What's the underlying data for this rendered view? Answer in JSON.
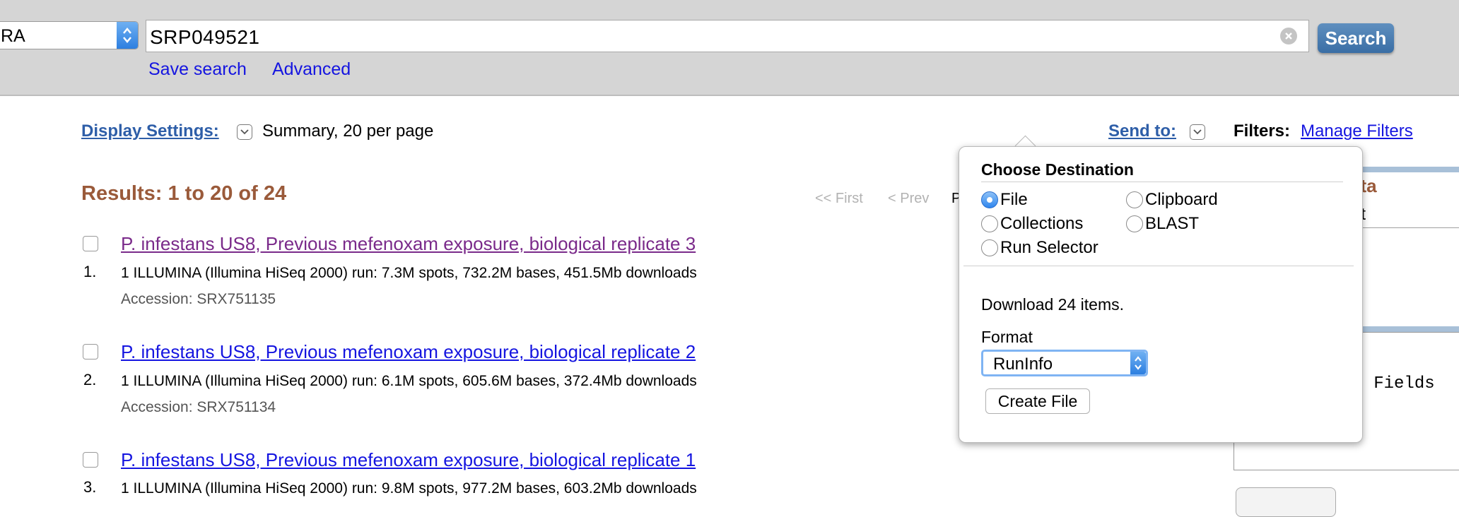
{
  "search": {
    "database_value": "RA",
    "query": "SRP049521",
    "button_label": "Search",
    "save_search_label": "Save search",
    "advanced_label": "Advanced"
  },
  "display": {
    "settings_label": "Display Settings:",
    "settings_value": "Summary, 20 per page",
    "send_to_label": "Send to:",
    "filters_label": "Filters:",
    "manage_filters_label": "Manage Filters"
  },
  "results": {
    "count_text": "Results: 1 to 20 of 24",
    "pager_first": "<< First",
    "pager_prev": "< Prev",
    "pager_clipped": "P",
    "items": [
      {
        "num": "1.",
        "title": "P. infestans US8, Previous mefenoxam exposure, biological replicate 3",
        "visited": true,
        "desc": "1 ILLUMINA (Illumina HiSeq 2000) run: 7.3M spots, 732.2M bases, 451.5Mb downloads",
        "accession": "Accession: SRX751135"
      },
      {
        "num": "2.",
        "title": "P. infestans US8, Previous mefenoxam exposure, biological replicate 2",
        "visited": false,
        "desc": "1 ILLUMINA (Illumina HiSeq 2000) run: 6.1M spots, 605.6M bases, 372.4Mb downloads",
        "accession": "Accession: SRX751134"
      },
      {
        "num": "3.",
        "title": "P. infestans US8, Previous mefenoxam exposure, biological replicate 1",
        "visited": false,
        "desc": "1 ILLUMINA (Illumina HiSeq 2000) run: 9.8M spots, 977.2M bases, 603.2Mb downloads",
        "accession": ""
      }
    ]
  },
  "side_panel": {
    "title_fragment": "ata",
    "select_fragment": "ect",
    "fields_fragment": "ll Fields"
  },
  "popup": {
    "title": "Choose Destination",
    "options": [
      "File",
      "Clipboard",
      "Collections",
      "BLAST",
      "Run Selector"
    ],
    "selected": "File",
    "download_text": "Download 24 items.",
    "format_label": "Format",
    "format_value": "RunInfo",
    "create_button": "Create File"
  },
  "colors": {
    "link": "#1515e0",
    "visited_link": "#7a2a8a",
    "heading_brown": "#9a5a3a",
    "ncbi_blue": "#2e5ea8",
    "topbar_bg": "#d5d5d5"
  }
}
